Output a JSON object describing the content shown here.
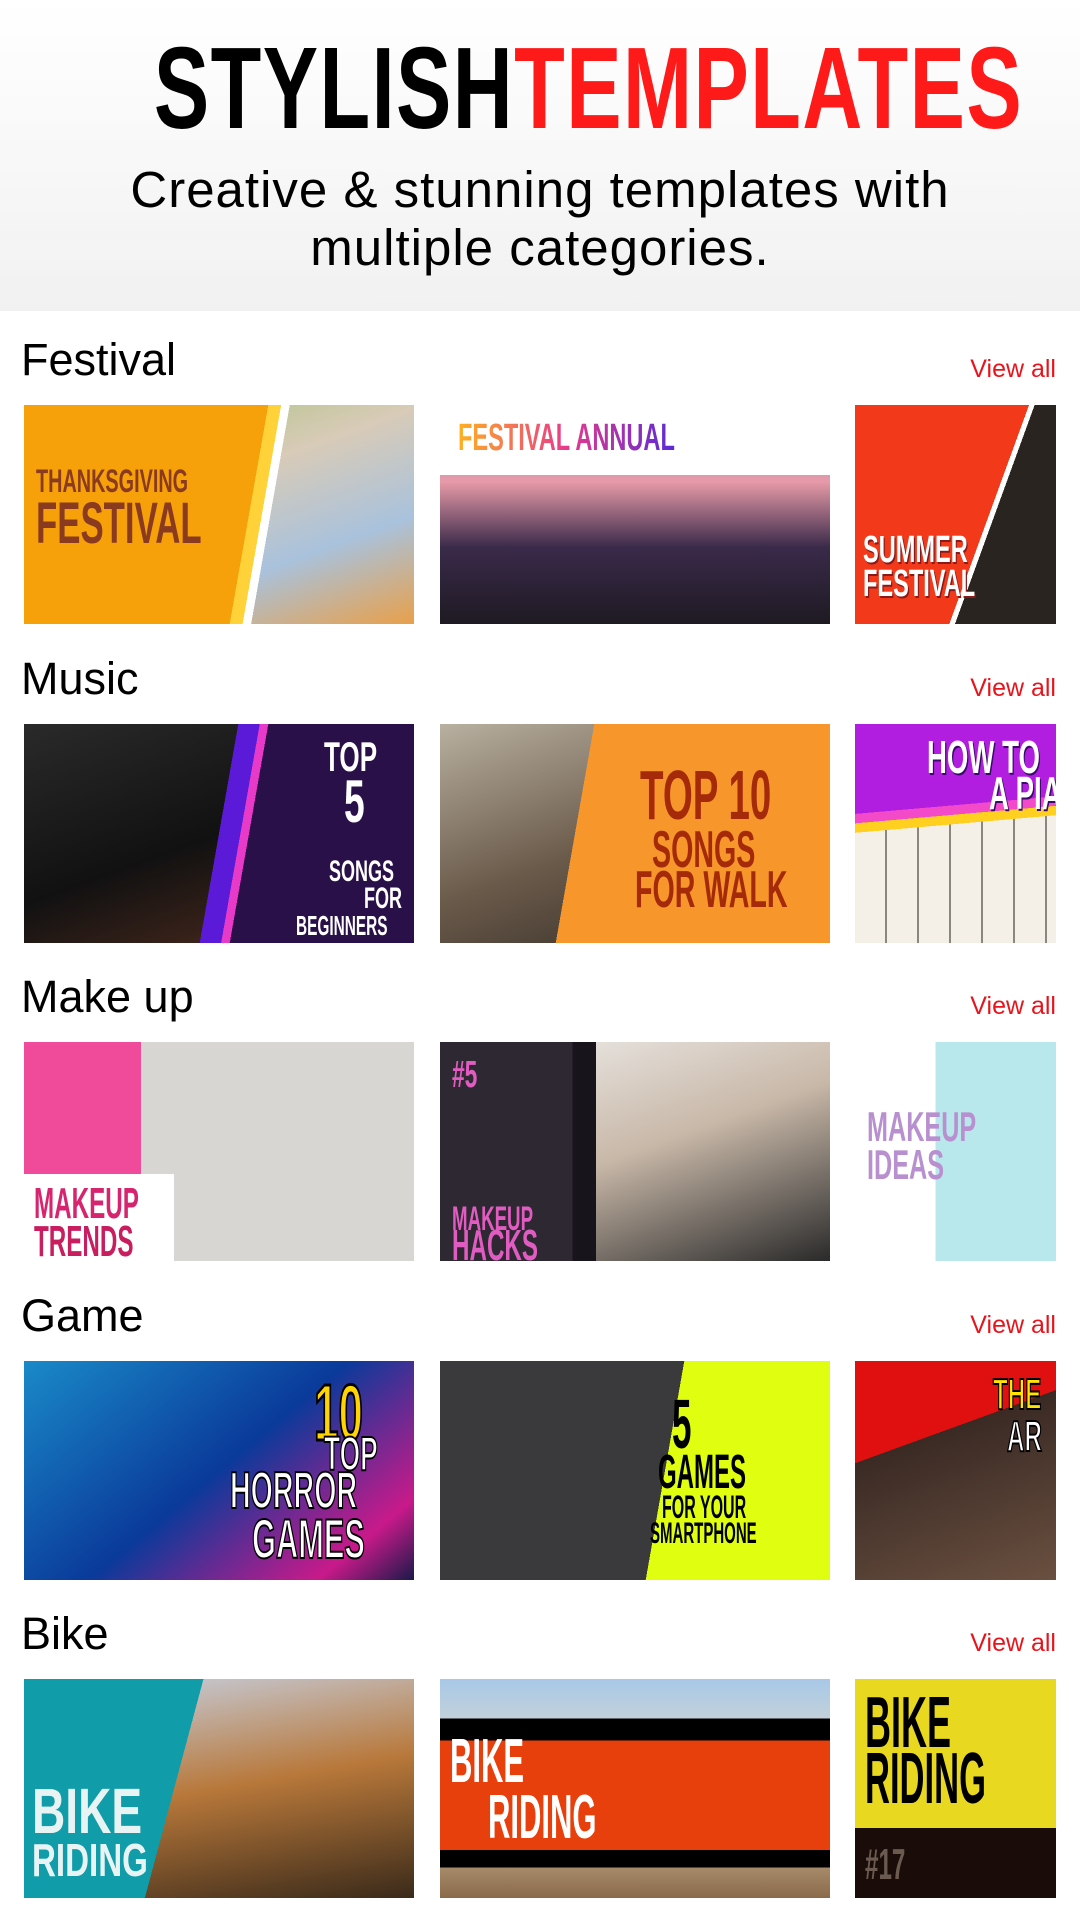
{
  "header": {
    "title_part1": "STYLISH",
    "title_part2": "TEMPLATES",
    "subtitle_line1": "Creative & stunning templates with",
    "subtitle_line2": "multiple categories."
  },
  "colors": {
    "accent": "#ff1a1a",
    "view_all": "#e8141c"
  },
  "sections": [
    {
      "title": "Festival",
      "view_all": "View all",
      "cards": [
        {
          "lines": [
            "THANKSGIVING",
            "FESTIVAL"
          ]
        },
        {
          "lines": [
            "FESTIVAL ANNUAL"
          ]
        },
        {
          "lines": [
            "SUMMER",
            "FESTIVAL"
          ]
        }
      ]
    },
    {
      "title": "Music",
      "view_all": "View all",
      "cards": [
        {
          "lines": [
            "TOP",
            "5",
            "SONGS",
            "FOR",
            "BEGINNERS"
          ]
        },
        {
          "lines": [
            "TOP 10",
            "SONGS",
            "FOR WALK"
          ]
        },
        {
          "lines": [
            "HOW TO",
            "A PIA"
          ]
        }
      ]
    },
    {
      "title": "Make up",
      "view_all": "View all",
      "cards": [
        {
          "lines": [
            "MAKEUP",
            "TRENDS"
          ]
        },
        {
          "lines": [
            "#5",
            "MAKEUP",
            "HACKS"
          ]
        },
        {
          "lines": [
            "MAKEUP",
            "IDEAS"
          ]
        }
      ]
    },
    {
      "title": "Game",
      "view_all": "View all",
      "cards": [
        {
          "lines": [
            "10",
            "TOP",
            "HORROR",
            "GAMES"
          ]
        },
        {
          "lines": [
            "5",
            "GAMES",
            "FOR YOUR",
            "SMARTPHONE"
          ]
        },
        {
          "lines": [
            "THE",
            "AR"
          ]
        }
      ]
    },
    {
      "title": "Bike",
      "view_all": "View all",
      "cards": [
        {
          "lines": [
            "BIKE",
            "RIDING"
          ]
        },
        {
          "lines": [
            "BIKE",
            "RIDING"
          ]
        },
        {
          "lines": [
            "BIKE",
            "RIDING",
            "#17"
          ]
        }
      ]
    }
  ]
}
